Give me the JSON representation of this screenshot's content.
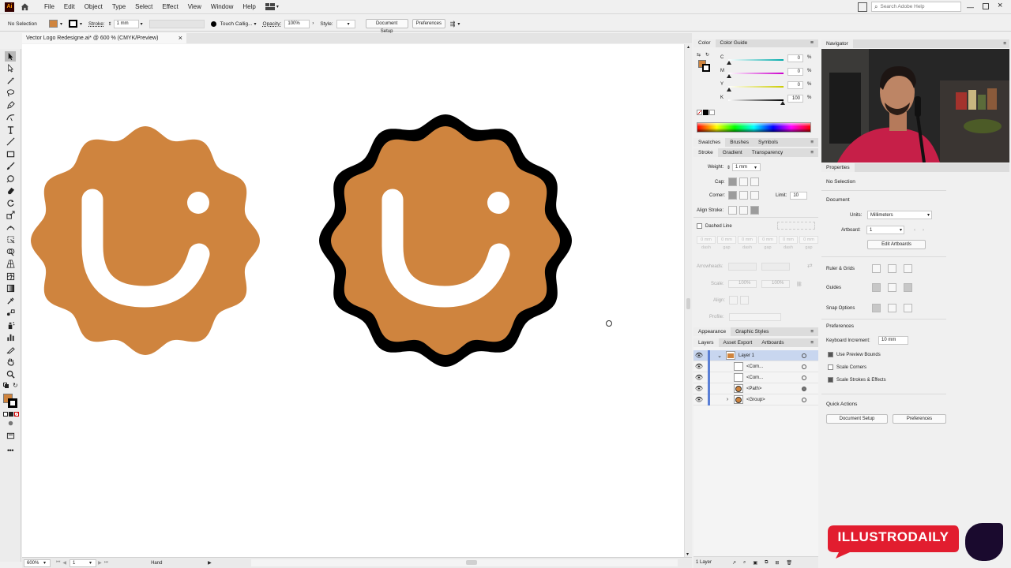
{
  "app": {
    "logo_text": "Ai",
    "search_placeholder": "Search Adobe Help"
  },
  "menu": [
    "File",
    "Edit",
    "Object",
    "Type",
    "Select",
    "Effect",
    "View",
    "Window",
    "Help"
  ],
  "control_bar": {
    "selection": "No Selection",
    "stroke_label": "Stroke:",
    "stroke_value": "1 mm",
    "brush": "Touch Callig...",
    "opacity_label": "Opacity:",
    "opacity_value": "100%",
    "style_label": "Style:",
    "doc_setup": "Document Setup",
    "preferences": "Preferences"
  },
  "document": {
    "tab_title": "Vector Logo Redesigne.ai* @ 600 % (CMYK/Preview)",
    "close": "×"
  },
  "colors": {
    "orange": "#cf843e",
    "black": "#000000",
    "white": "#ffffff",
    "youtube_red": "#e21d2f",
    "dark_blob": "#1a0a2e"
  },
  "color_panel": {
    "tabs": [
      "Color",
      "Color Guide"
    ],
    "channels": [
      {
        "label": "C",
        "value": "0"
      },
      {
        "label": "M",
        "value": "0"
      },
      {
        "label": "Y",
        "value": "0"
      },
      {
        "label": "K",
        "value": "100"
      }
    ],
    "pct": "%"
  },
  "swatch_tabs": [
    "Swatches",
    "Brushes",
    "Symbols"
  ],
  "stroke_panel": {
    "tabs": [
      "Stroke",
      "Gradient",
      "Transparency"
    ],
    "weight_label": "Weight:",
    "weight_value": "1 mm",
    "cap_label": "Cap:",
    "corner_label": "Corner:",
    "limit_label": "Limit:",
    "limit_value": "10",
    "align_label": "Align Stroke:",
    "dashed_label": "Dashed Line",
    "dash_labels": [
      "dash",
      "gap",
      "dash",
      "gap",
      "dash",
      "gap"
    ],
    "dash_values": [
      "0 mm",
      "0 mm",
      "0 mm",
      "0 mm",
      "0 mm",
      "0 mm"
    ],
    "arrowheads_label": "Arrowheads:",
    "scale_label": "Scale:",
    "scale_value": "100%",
    "align_arrow_label": "Align:",
    "profile_label": "Profile:"
  },
  "appearance_tabs": [
    "Appearance",
    "Graphic Styles"
  ],
  "layers_panel": {
    "tabs": [
      "Layers",
      "Asset Export",
      "Artboards"
    ],
    "rows": [
      {
        "name": "Layer 1",
        "indent": 0,
        "expanded": true
      },
      {
        "name": "<Com...",
        "indent": 1,
        "expanded": false
      },
      {
        "name": "<Com...",
        "indent": 1,
        "expanded": false
      },
      {
        "name": "<Path>",
        "indent": 1,
        "expanded": false
      },
      {
        "name": "<Group>",
        "indent": 1,
        "expanded": false
      }
    ],
    "count": "1 Layer"
  },
  "navigator": {
    "title": "Navigator"
  },
  "properties": {
    "title": "Properties",
    "selection": "No Selection",
    "document_label": "Document",
    "units_label": "Units:",
    "units_value": "Millimeters",
    "artboard_label": "Artboard:",
    "artboard_value": "1",
    "edit_artboards": "Edit Artboards",
    "ruler_grids": "Ruler & Grids",
    "guides": "Guides",
    "snap_options": "Snap Options",
    "preferences_label": "Preferences",
    "keyboard_increment_label": "Keyboard Increment:",
    "keyboard_increment_value": "10 mm",
    "use_preview_bounds": "Use Preview Bounds",
    "scale_corners": "Scale Corners",
    "scale_strokes": "Scale Strokes & Effects",
    "quick_actions": "Quick Actions",
    "doc_setup": "Document Setup",
    "preferences_btn": "Preferences"
  },
  "status": {
    "zoom": "600%",
    "artboard": "1",
    "tool": "Hand"
  },
  "watermark": {
    "brand": "ILLUSTRODAILY"
  }
}
